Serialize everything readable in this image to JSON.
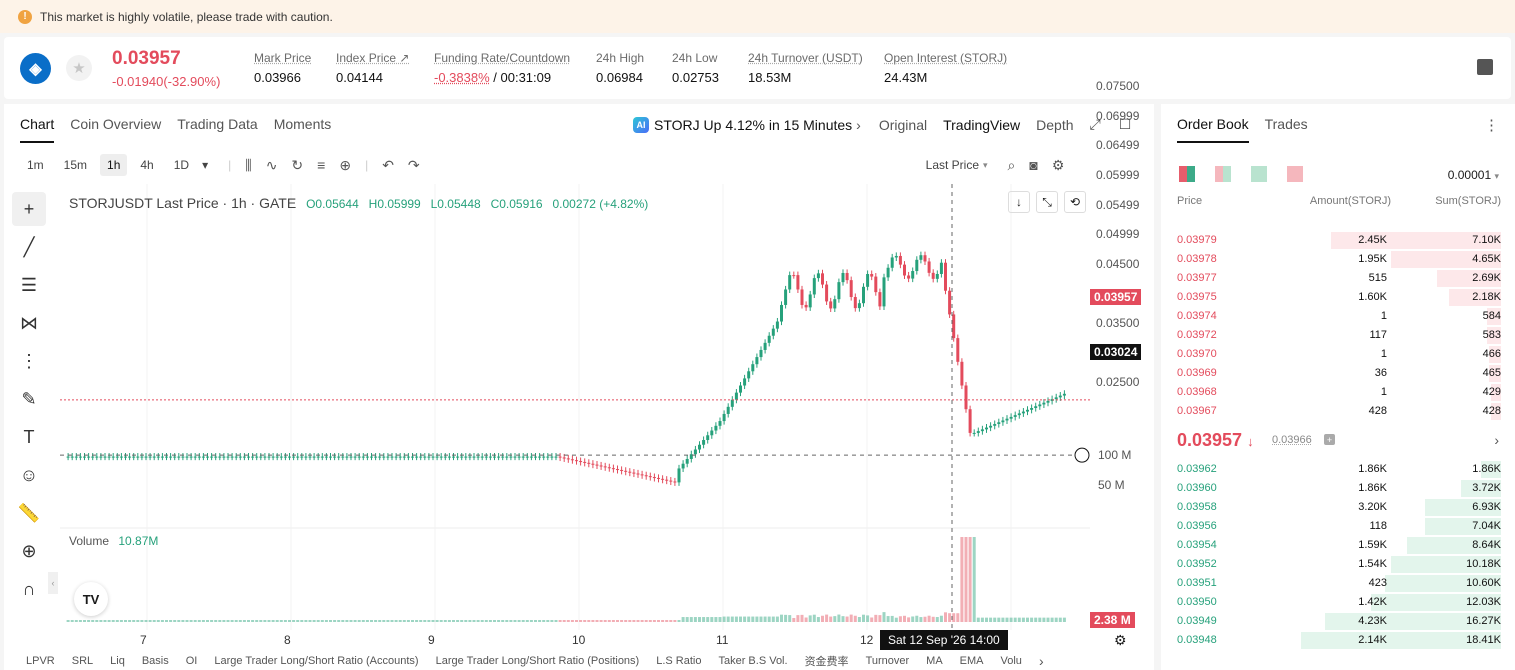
{
  "banner": {
    "text": "This market is highly volatile, please trade with caution."
  },
  "ticker": {
    "symbol_icon": "storj-logo",
    "last_price": "0.03957",
    "change": "-0.01940(-32.90%)",
    "stats": [
      {
        "label": "Mark Price",
        "value": "0.03966"
      },
      {
        "label": "Index Price ↗",
        "value": "0.04144"
      },
      {
        "label": "Funding Rate/Countdown",
        "value_red": "-0.3838%",
        "value": " / 00:31:09"
      },
      {
        "label": "24h High",
        "value": "0.06984"
      },
      {
        "label": "24h Low",
        "value": "0.02753"
      },
      {
        "label": "24h Turnover (USDT)",
        "value": "18.53M"
      },
      {
        "label": "Open Interest (STORJ)",
        "value": "24.43M"
      }
    ]
  },
  "chart_tabs": [
    "Chart",
    "Coin Overview",
    "Trading Data",
    "Moments"
  ],
  "chart_alert": "STORJ Up 4.12% in 15 Minutes",
  "chart_views": [
    "Original",
    "TradingView",
    "Depth"
  ],
  "timeframes": [
    "1m",
    "15m",
    "1h",
    "4h",
    "1D"
  ],
  "price_type": "Last Price",
  "ohlc": {
    "title": "STORJUSDT Last Price · 1h · GATE",
    "o": "O0.05644",
    "h": "H0.05999",
    "l": "L0.05448",
    "c": "C0.05916",
    "chg": "0.00272 (+4.82%)"
  },
  "volume": {
    "label": "Volume",
    "value": "10.87M"
  },
  "price_axis": [
    "0.07500",
    "0.06999",
    "0.06499",
    "0.05999",
    "0.05499",
    "0.04999",
    "0.04500",
    "0.03957",
    "0.03500",
    "0.03024",
    "0.02500"
  ],
  "volume_axis": [
    "100 M",
    "50 M",
    "2.38 M"
  ],
  "time_axis": [
    "7",
    "8",
    "9",
    "10",
    "11",
    "12",
    "Sat 12 Sep '26",
    "14:00"
  ],
  "indicators": [
    "LPVR",
    "SRL",
    "Liq",
    "Basis",
    "OI",
    "Large Trader Long/Short Ratio (Accounts)",
    "Large Trader Long/Short Ratio (Positions)",
    "L.S Ratio",
    "Taker B.S Vol.",
    "资金费率",
    "Turnover",
    "MA",
    "EMA",
    "Volu"
  ],
  "chart_data": {
    "type": "candlestick",
    "x_labels": [
      "7",
      "8",
      "9",
      "10",
      "11",
      "12"
    ],
    "y_range": [
      0.022,
      0.075
    ],
    "last_price": 0.03957,
    "crosshair_price": 0.03024
  },
  "orderbook": {
    "tabs": [
      "Order Book",
      "Trades"
    ],
    "precision": "0.00001",
    "headers": [
      "Price",
      "Amount(STORJ)",
      "Sum(STORJ)"
    ],
    "asks": [
      {
        "p": "0.03979",
        "a": "2.45K",
        "s": "7.10K",
        "d": 0.85
      },
      {
        "p": "0.03978",
        "a": "1.95K",
        "s": "4.65K",
        "d": 0.55
      },
      {
        "p": "0.03977",
        "a": "515",
        "s": "2.69K",
        "d": 0.32
      },
      {
        "p": "0.03975",
        "a": "1.60K",
        "s": "2.18K",
        "d": 0.26
      },
      {
        "p": "0.03974",
        "a": "1",
        "s": "584",
        "d": 0.07
      },
      {
        "p": "0.03972",
        "a": "117",
        "s": "583",
        "d": 0.07
      },
      {
        "p": "0.03970",
        "a": "1",
        "s": "466",
        "d": 0.06
      },
      {
        "p": "0.03969",
        "a": "36",
        "s": "465",
        "d": 0.06
      },
      {
        "p": "0.03968",
        "a": "1",
        "s": "429",
        "d": 0.05
      },
      {
        "p": "0.03967",
        "a": "428",
        "s": "428",
        "d": 0.05
      }
    ],
    "mid_price": "0.03957",
    "mid_mark": "0.03966",
    "bids": [
      {
        "p": "0.03962",
        "a": "1.86K",
        "s": "1.86K",
        "d": 0.1
      },
      {
        "p": "0.03960",
        "a": "1.86K",
        "s": "3.72K",
        "d": 0.2
      },
      {
        "p": "0.03958",
        "a": "3.20K",
        "s": "6.93K",
        "d": 0.38
      },
      {
        "p": "0.03956",
        "a": "118",
        "s": "7.04K",
        "d": 0.38
      },
      {
        "p": "0.03954",
        "a": "1.59K",
        "s": "8.64K",
        "d": 0.47
      },
      {
        "p": "0.03952",
        "a": "1.54K",
        "s": "10.18K",
        "d": 0.55
      },
      {
        "p": "0.03951",
        "a": "423",
        "s": "10.60K",
        "d": 0.58
      },
      {
        "p": "0.03950",
        "a": "1.42K",
        "s": "12.03K",
        "d": 0.65
      },
      {
        "p": "0.03949",
        "a": "4.23K",
        "s": "16.27K",
        "d": 0.88
      },
      {
        "p": "0.03948",
        "a": "2.14K",
        "s": "18.41K",
        "d": 1.0
      }
    ]
  },
  "colors": {
    "up": "#26a17b",
    "down": "#e34b5c"
  }
}
